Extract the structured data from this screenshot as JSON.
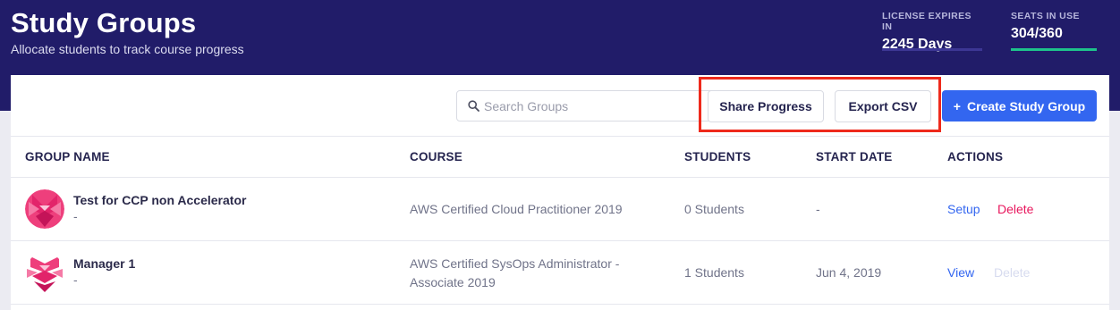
{
  "header": {
    "title": "Study Groups",
    "subtitle": "Allocate students to track course progress",
    "stats": [
      {
        "label": "LICENSE EXPIRES IN",
        "value": "2245 Days",
        "bar_color": "#3c3694",
        "fill_fraction": 0
      },
      {
        "label": "SEATS IN USE",
        "value": "304/360",
        "bar_color": "#1ec28b",
        "fill_fraction": 1
      }
    ]
  },
  "toolbar": {
    "search_placeholder": "Search Groups",
    "share_label": "Share Progress",
    "export_label": "Export CSV",
    "create_label": "Create Study Group",
    "create_icon": "+"
  },
  "table": {
    "columns": [
      "GROUP NAME",
      "COURSE",
      "STUDENTS",
      "START DATE",
      "ACTIONS"
    ],
    "rows": [
      {
        "name": "Test for CCP non Accelerator",
        "sub": "-",
        "course_line1": "AWS Certified Cloud Practitioner 2019",
        "course_line2": "",
        "students": "0 Students",
        "start_date": "-",
        "primary_action": "Setup",
        "delete_label": "Delete",
        "delete_enabled": true
      },
      {
        "name": "Manager 1",
        "sub": "-",
        "course_line1": "AWS Certified SysOps Administrator -",
        "course_line2": "Associate 2019",
        "students": "1 Students",
        "start_date": "Jun 4, 2019",
        "primary_action": "View",
        "delete_label": "Delete",
        "delete_enabled": false
      }
    ]
  },
  "colors": {
    "header_bg": "#211c69",
    "primary": "#3366f0",
    "delete_active": "#e8175d",
    "delete_disabled": "#d7dbef",
    "highlight": "#ee2a1c"
  }
}
